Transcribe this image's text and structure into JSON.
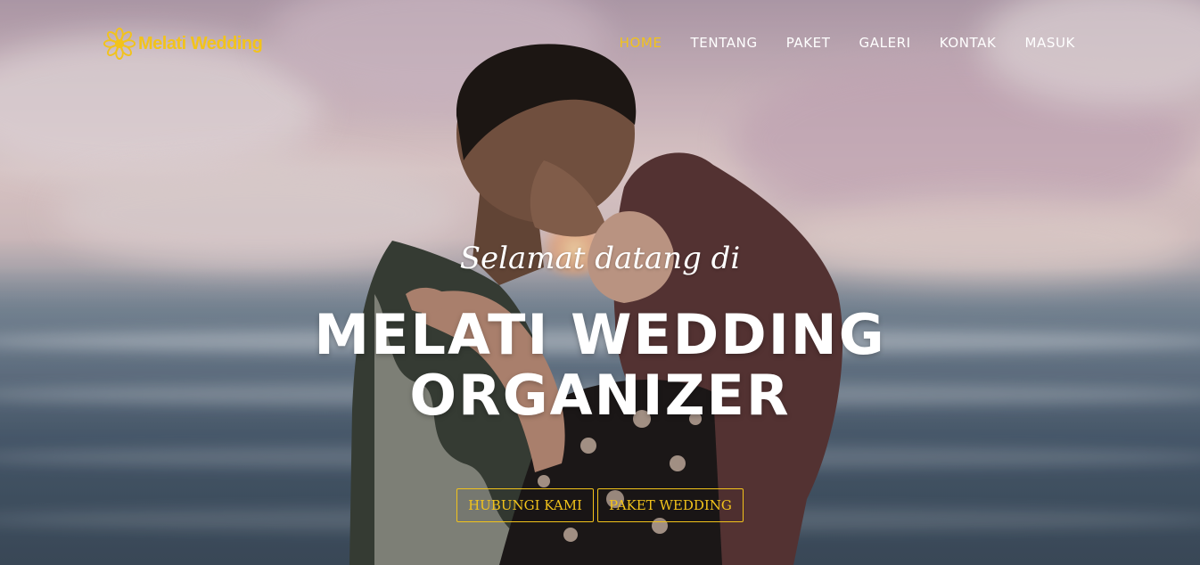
{
  "brand": {
    "name": "Melati Wedding",
    "icon": "flower-icon",
    "color": "#f2c31b"
  },
  "nav": {
    "items": [
      {
        "label": "HOME",
        "active": true
      },
      {
        "label": "TENTANG",
        "active": false
      },
      {
        "label": "PAKET",
        "active": false
      },
      {
        "label": "GALERI",
        "active": false
      },
      {
        "label": "KONTAK",
        "active": false
      },
      {
        "label": "MASUK",
        "active": false
      }
    ],
    "active_color": "#f2c31b"
  },
  "hero": {
    "tagline": "Selamat datang di",
    "headline": "MELATI WEDDING ORGANIZER",
    "buttons": {
      "contact_label": "HUBUNGI KAMI",
      "package_label": "PAKET WEDDING"
    }
  }
}
